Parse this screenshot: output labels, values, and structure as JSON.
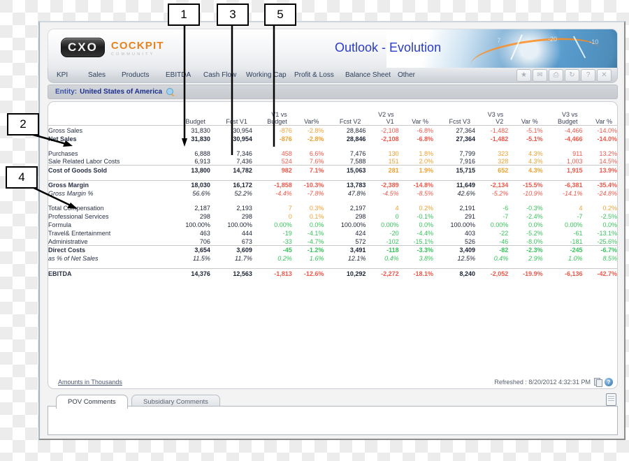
{
  "app": {
    "logo_badge": "CXO",
    "logo_word": "COCKPIT",
    "logo_sub": "COMMUNITY",
    "title": "Outlook - Evolution"
  },
  "menu": {
    "items": [
      {
        "label": "KPI"
      },
      {
        "label": "Sales"
      },
      {
        "label": "Products"
      },
      {
        "label": "EBITDA"
      },
      {
        "label": "Cash Flow"
      },
      {
        "label": "Working Cap"
      },
      {
        "label": "Profit & Loss"
      },
      {
        "label": "Balance Sheet"
      },
      {
        "label": "Other"
      }
    ],
    "tool_icons": [
      {
        "name": "favorite-icon",
        "glyph": "★"
      },
      {
        "name": "email-icon",
        "glyph": "✉"
      },
      {
        "name": "print-icon",
        "glyph": "⎙"
      },
      {
        "name": "refresh-icon",
        "glyph": "↻"
      },
      {
        "name": "help-icon",
        "glyph": "?"
      },
      {
        "name": "close-icon",
        "glyph": "✕"
      }
    ]
  },
  "entity": {
    "label": "Entity:",
    "value": "United States of America"
  },
  "table": {
    "headers": [
      {
        "line1": "",
        "line2": "Budget"
      },
      {
        "line1": "",
        "line2": "Fcst V1"
      },
      {
        "line1": "V1 vs",
        "line2": "Budget"
      },
      {
        "line1": "",
        "line2": "Var%"
      },
      {
        "line1": "",
        "line2": "Fcst V2"
      },
      {
        "line1": "V2 vs",
        "line2": "V1"
      },
      {
        "line1": "",
        "line2": "Var %"
      },
      {
        "line1": "",
        "line2": "Fcst V3"
      },
      {
        "line1": "V3 vs",
        "line2": "V2"
      },
      {
        "line1": "",
        "line2": "Var %"
      },
      {
        "line1": "V3 vs",
        "line2": "Budget"
      },
      {
        "line1": "",
        "line2": "Var %"
      }
    ],
    "rows": [
      {
        "label": "Gross Sales",
        "expand": true,
        "style": "",
        "topline": true,
        "cells": [
          "31,830",
          "30,954",
          "-876",
          "-2.8%",
          "28,846",
          "-2,108",
          "-6.8%",
          "27,364",
          "-1,482",
          "-5.1%",
          "-4,466",
          "-14.0%"
        ],
        "colors": [
          "dk",
          "dk",
          "pos",
          "pos",
          "dk",
          "neg",
          "neg",
          "dk",
          "neg",
          "neg",
          "neg",
          "neg"
        ]
      },
      {
        "label": "Net Sales",
        "expand": false,
        "style": "bold",
        "topline": false,
        "cells": [
          "31,830",
          "30,954",
          "-876",
          "-2.8%",
          "28,846",
          "-2,108",
          "-6.8%",
          "27,364",
          "-1,482",
          "-5.1%",
          "-4,466",
          "-14.0%"
        ],
        "colors": [
          "dk",
          "dk",
          "pos",
          "pos",
          "dk",
          "neg",
          "neg",
          "dk",
          "neg",
          "neg",
          "neg",
          "neg"
        ]
      },
      {
        "spacer": true
      },
      {
        "label": "Purchases",
        "expand": false,
        "style": "",
        "topline": false,
        "cells": [
          "6,888",
          "7,346",
          "458",
          "6.6%",
          "7,476",
          "130",
          "1.8%",
          "7,799",
          "323",
          "4.3%",
          "911",
          "13.2%"
        ],
        "colors": [
          "dk",
          "dk",
          "neg",
          "neg",
          "dk",
          "pos",
          "pos",
          "dk",
          "pos",
          "pos",
          "neg",
          "neg"
        ]
      },
      {
        "label": "Sale Related Labor Costs",
        "expand": false,
        "style": "",
        "topline": false,
        "cells": [
          "6,913",
          "7,436",
          "524",
          "7.6%",
          "7,588",
          "151",
          "2.0%",
          "7,916",
          "328",
          "4.3%",
          "1,003",
          "14.5%"
        ],
        "colors": [
          "dk",
          "dk",
          "neg",
          "neg",
          "dk",
          "pos",
          "pos",
          "dk",
          "pos",
          "pos",
          "neg",
          "neg"
        ]
      },
      {
        "label": "Cost of Goods Sold",
        "expand": false,
        "style": "bold",
        "topline": true,
        "cells": [
          "13,800",
          "14,782",
          "982",
          "7.1%",
          "15,063",
          "281",
          "1.9%",
          "15,715",
          "652",
          "4.3%",
          "1,915",
          "13.9%"
        ],
        "colors": [
          "dk",
          "dk",
          "neg",
          "neg",
          "dk",
          "pos",
          "pos",
          "dk",
          "pos",
          "pos",
          "neg",
          "neg"
        ]
      },
      {
        "spacer": true
      },
      {
        "label": "Gross Margin",
        "expand": false,
        "style": "bold",
        "topline": true,
        "cells": [
          "18,030",
          "16,172",
          "-1,858",
          "-10.3%",
          "13,783",
          "-2,389",
          "-14.8%",
          "11,649",
          "-2,134",
          "-15.5%",
          "-6,381",
          "-35.4%"
        ],
        "colors": [
          "dk",
          "dk",
          "neg",
          "neg",
          "dk",
          "neg",
          "neg",
          "dk",
          "neg",
          "neg",
          "neg",
          "neg"
        ]
      },
      {
        "label": "Gross Margin %",
        "expand": false,
        "style": "ital",
        "topline": false,
        "cells": [
          "56.6%",
          "52.2%",
          "-4.4%",
          "-7.8%",
          "47.8%",
          "-4.5%",
          "-8.5%",
          "42.6%",
          "-5.2%",
          "-10.9%",
          "-14.1%",
          "-24.8%"
        ],
        "colors": [
          "dk",
          "dk",
          "neg",
          "neg",
          "dk",
          "neg",
          "neg",
          "dk",
          "neg",
          "neg",
          "neg",
          "neg"
        ]
      },
      {
        "spacer": true
      },
      {
        "label": "Total Compensation",
        "expand": true,
        "style": "",
        "topline": false,
        "cells": [
          "2,187",
          "2,193",
          "7",
          "0.3%",
          "2,197",
          "4",
          "0.2%",
          "2,191",
          "-6",
          "-0.3%",
          "4",
          "0.2%"
        ],
        "colors": [
          "dk",
          "dk",
          "pos",
          "pos",
          "dk",
          "pos",
          "pos",
          "dk",
          "grn",
          "grn",
          "pos",
          "pos"
        ]
      },
      {
        "label": "Professional Services",
        "expand": true,
        "style": "",
        "topline": false,
        "cells": [
          "298",
          "298",
          "0",
          "0.1%",
          "298",
          "0",
          "-0.1%",
          "291",
          "-7",
          "-2.4%",
          "-7",
          "-2.5%"
        ],
        "colors": [
          "dk",
          "dk",
          "pos",
          "pos",
          "dk",
          "grn",
          "grn",
          "dk",
          "grn",
          "grn",
          "grn",
          "grn"
        ]
      },
      {
        "label": "Formula",
        "expand": false,
        "style": "",
        "topline": false,
        "cells": [
          "100.00%",
          "100.00%",
          "0.00%",
          "0.0%",
          "100.00%",
          "0.00%",
          "0.0%",
          "100.00%",
          "0.00%",
          "0.0%",
          "0.00%",
          "0.0%"
        ],
        "colors": [
          "dk",
          "dk",
          "grn",
          "grn",
          "dk",
          "grn",
          "grn",
          "dk",
          "grn",
          "grn",
          "grn",
          "grn"
        ]
      },
      {
        "label": "Travel& Entertainment",
        "expand": true,
        "style": "",
        "topline": false,
        "cells": [
          "463",
          "444",
          "-19",
          "-4.1%",
          "424",
          "-20",
          "-4.4%",
          "403",
          "-22",
          "-5.2%",
          "-61",
          "-13.1%"
        ],
        "colors": [
          "dk",
          "dk",
          "grn",
          "grn",
          "dk",
          "grn",
          "grn",
          "dk",
          "grn",
          "grn",
          "grn",
          "grn"
        ]
      },
      {
        "label": "Administrative",
        "expand": true,
        "style": "",
        "topline": false,
        "cells": [
          "706",
          "673",
          "-33",
          "-4.7%",
          "572",
          "-102",
          "-15.1%",
          "526",
          "-46",
          "-8.0%",
          "-181",
          "-25.6%"
        ],
        "colors": [
          "dk",
          "dk",
          "grn",
          "grn",
          "dk",
          "grn",
          "grn",
          "dk",
          "grn",
          "grn",
          "grn",
          "grn"
        ]
      },
      {
        "label": "Direct Costs",
        "expand": false,
        "style": "bold",
        "topline": true,
        "cells": [
          "3,654",
          "3,609",
          "-45",
          "-1.2%",
          "3,491",
          "-118",
          "-3.3%",
          "3,409",
          "-82",
          "-2.3%",
          "-245",
          "-6.7%"
        ],
        "colors": [
          "dk",
          "dk",
          "grn",
          "grn",
          "dk",
          "grn",
          "grn",
          "dk",
          "grn",
          "grn",
          "grn",
          "grn"
        ]
      },
      {
        "label": "as % of Net Sales",
        "expand": false,
        "style": "ital",
        "topline": false,
        "cells": [
          "11.5%",
          "11.7%",
          "0.2%",
          "1.6%",
          "12.1%",
          "0.4%",
          "3.8%",
          "12.5%",
          "0.4%",
          "2.9%",
          "1.0%",
          "8.5%"
        ],
        "colors": [
          "dk",
          "dk",
          "grn",
          "grn",
          "dk",
          "grn",
          "grn",
          "dk",
          "grn",
          "grn",
          "grn",
          "grn"
        ]
      },
      {
        "spacer": true
      },
      {
        "label": "EBITDA",
        "expand": false,
        "style": "bold",
        "topline": true,
        "cells": [
          "14,376",
          "12,563",
          "-1,813",
          "-12.6%",
          "10,292",
          "-2,272",
          "-18.1%",
          "8,240",
          "-2,052",
          "-19.9%",
          "-6,136",
          "-42.7%"
        ],
        "colors": [
          "dk",
          "dk",
          "neg",
          "neg",
          "dk",
          "neg",
          "neg",
          "dk",
          "neg",
          "neg",
          "neg",
          "neg"
        ]
      }
    ]
  },
  "report_footer": {
    "amounts": "Amounts in Thousands",
    "refreshed": "Refreshed : 8/20/2012 4:32:31 PM"
  },
  "comment_tabs": [
    {
      "label": "POV Comments",
      "active": true
    },
    {
      "label": "Subsidiary Comments",
      "active": false
    }
  ],
  "callouts": [
    {
      "number": "1"
    },
    {
      "number": "2"
    },
    {
      "number": "3"
    },
    {
      "number": "4"
    },
    {
      "number": "5"
    }
  ],
  "colors": {
    "accent_blue": "#2a3cc8",
    "brand_orange": "#e8821e",
    "positive": "#f0a030",
    "negative": "#f0574a",
    "green": "#36c45a"
  }
}
